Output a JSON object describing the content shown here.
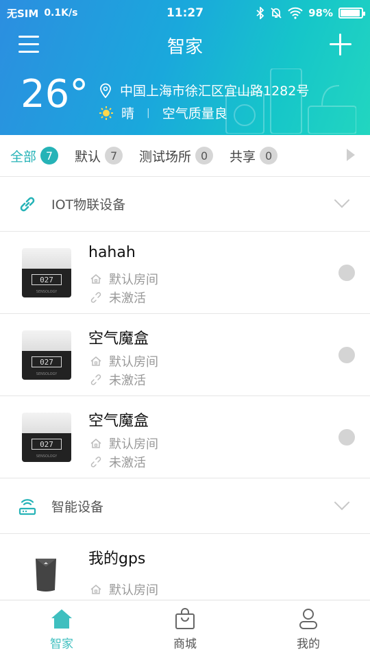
{
  "status_bar": {
    "carrier": "无SIM",
    "speed": "0.1K/s",
    "time": "11:27",
    "battery": "98%"
  },
  "header": {
    "title": "智家",
    "temperature": "26°",
    "location": "中国上海市徐汇区宜山路1282号",
    "weather": "晴",
    "air_quality": "空气质量良",
    "accent_color": "#26b3b7"
  },
  "tabs": [
    {
      "label": "全部",
      "count": "7",
      "active": true
    },
    {
      "label": "默认",
      "count": "7"
    },
    {
      "label": "测试场所",
      "count": "0"
    },
    {
      "label": "共享",
      "count": "0"
    }
  ],
  "groups": [
    {
      "title": "IOT物联设备",
      "icon": "link-icon",
      "devices": [
        {
          "name": "hahah",
          "room": "默认房间",
          "status": "未激活",
          "screen": "027",
          "brand": "SENSOLOGY"
        },
        {
          "name": "空气魔盒",
          "room": "默认房间",
          "status": "未激活",
          "screen": "027",
          "brand": "SENSOLOGY"
        },
        {
          "name": "空气魔盒",
          "room": "默认房间",
          "status": "未激活",
          "screen": "027",
          "brand": "SENSOLOGY"
        }
      ]
    },
    {
      "title": "智能设备",
      "icon": "router-icon",
      "devices": [
        {
          "name": "我的gps",
          "room": "默认房间"
        }
      ]
    }
  ],
  "bottom_nav": [
    {
      "label": "智家",
      "icon": "home-icon",
      "active": true
    },
    {
      "label": "商城",
      "icon": "shopping-bag-icon"
    },
    {
      "label": "我的",
      "icon": "user-icon"
    }
  ]
}
